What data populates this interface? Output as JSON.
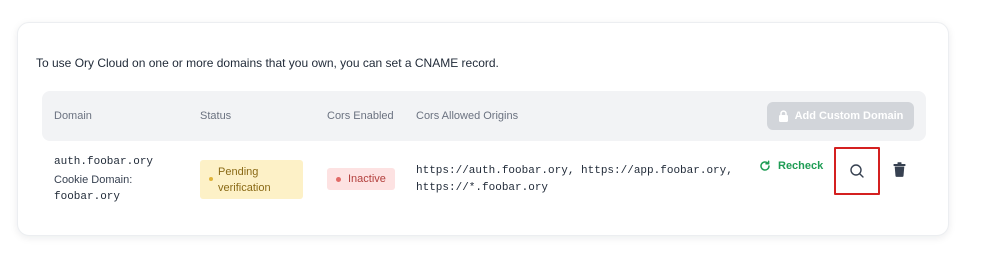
{
  "intro_text": "To use Ory Cloud on one or more domains that you own, you can set a CNAME record.",
  "table": {
    "columns": [
      "Domain",
      "Status",
      "Cors Enabled",
      "Cors Allowed Origins"
    ],
    "add_button_label": "Add Custom Domain",
    "rows": [
      {
        "domain": "auth.foobar.ory",
        "cookie_domain_label": "Cookie Domain:",
        "cookie_domain": "foobar.ory",
        "status": "Pending verification",
        "status_line1": "Pending",
        "status_line2": "verification",
        "cors_enabled": "Inactive",
        "origins_line1": "https://auth.foobar.ory, https://app.foobar.ory,",
        "origins_line2": "https://*.foobar.ory",
        "recheck_label": "Recheck"
      }
    ]
  },
  "colors": {
    "pending_badge_bg": "#fdf1c7",
    "inactive_badge_bg": "#fde2e2",
    "recheck_green": "#1f9d55",
    "highlight_red": "#d42020"
  },
  "icons": {
    "add": "lock-icon",
    "recheck": "refresh-icon",
    "inspect": "search-icon",
    "delete": "trash-icon"
  }
}
